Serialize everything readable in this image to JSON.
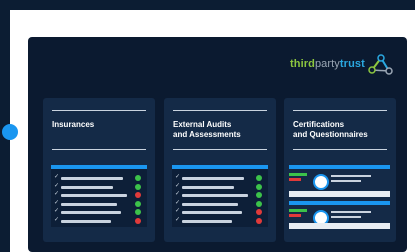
{
  "logo": {
    "part1": "third",
    "part2": "party",
    "part3": "trust",
    "icon": "connected-nodes-icon"
  },
  "cards": [
    {
      "title_line1": "Insurances",
      "title_line2": ""
    },
    {
      "title_line1": "External Audits",
      "title_line2": "and Assessments"
    },
    {
      "title_line1": "Certifications",
      "title_line2": "and Questionnaires"
    }
  ],
  "checklist_status": {
    "insurances": [
      "ok",
      "ok",
      "fail",
      "ok",
      "ok",
      "fail"
    ],
    "audits": [
      "ok",
      "ok",
      "ok",
      "ok",
      "fail",
      "fail"
    ]
  },
  "colors": {
    "background": "#0c1d33",
    "card": "#142a47",
    "accent_blue": "#1a96f0",
    "ok": "#3cc24a",
    "fail": "#e03a3a",
    "logo_green": "#8cc63f",
    "logo_blue": "#2aa8e0"
  }
}
